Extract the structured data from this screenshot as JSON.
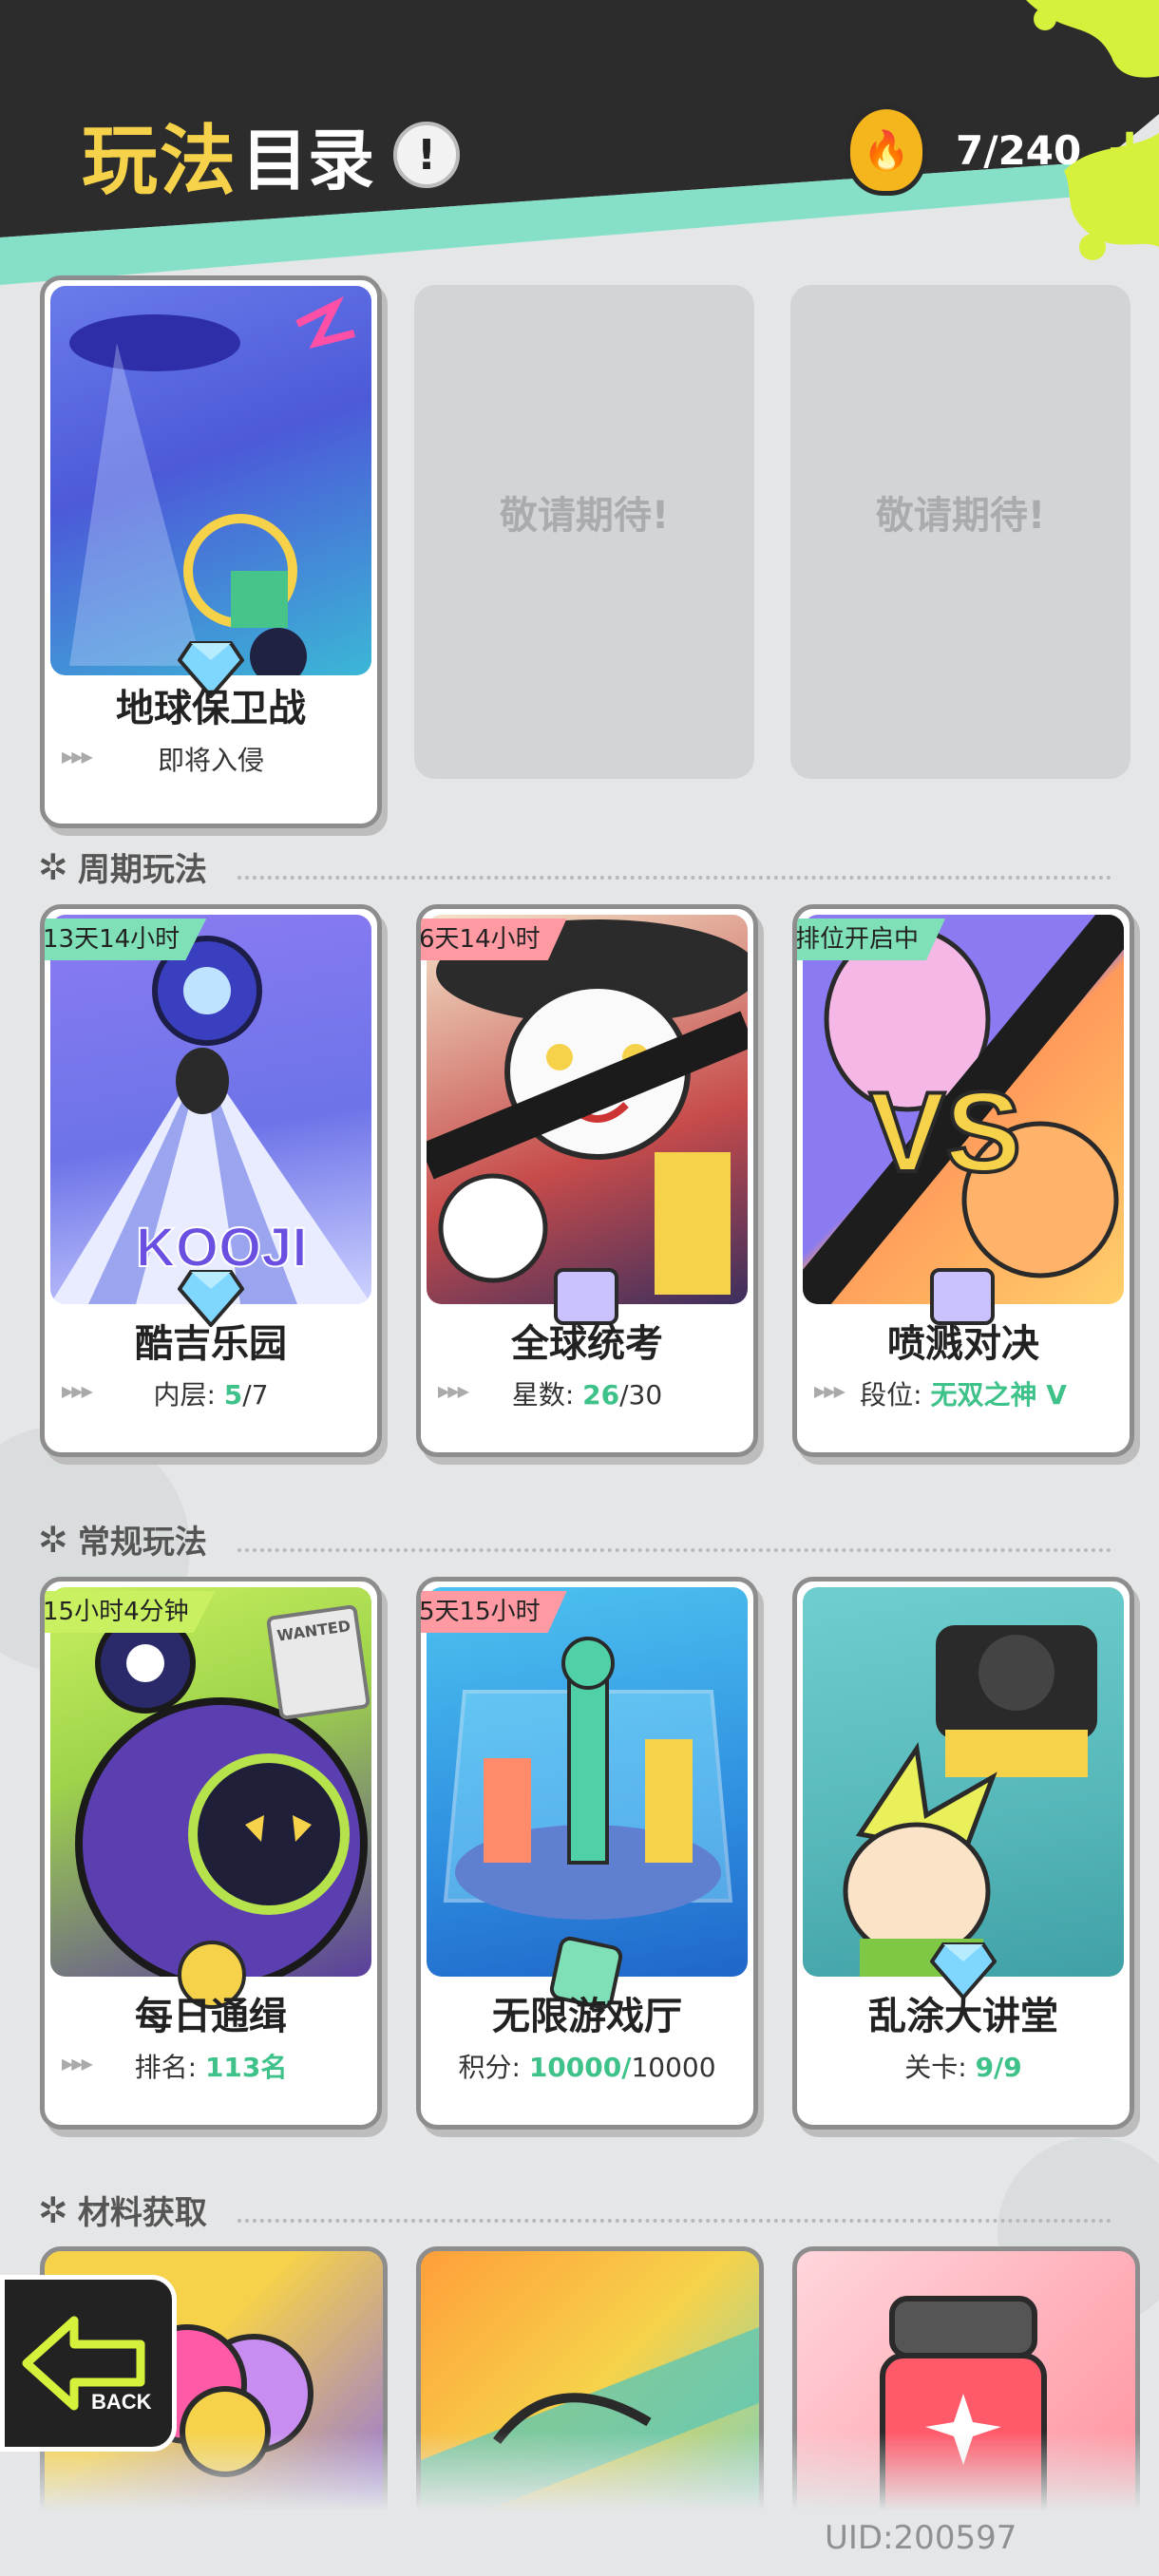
{
  "header": {
    "title_part1": "玩法",
    "title_part2": "目录",
    "info_glyph": "!",
    "currency_value": "7/240",
    "plus_glyph": "+"
  },
  "featured": {
    "card": {
      "title": "地球保卫战",
      "subtitle": "即将入侵"
    },
    "placeholder_1": "敬请期待!",
    "placeholder_2": "敬请期待!"
  },
  "sections": {
    "periodic": "周期玩法",
    "regular": "常规玩法",
    "materials": "材料获取"
  },
  "periodic_cards": [
    {
      "badge": "13天14小时",
      "title": "酷吉乐园",
      "sub_label": "内层:",
      "sub_value": "5",
      "sub_rest": "/7",
      "art_text": "KOOJI"
    },
    {
      "badge": "6天14小时",
      "title": "全球统考",
      "sub_label": "星数:",
      "sub_value": "26",
      "sub_rest": "/30"
    },
    {
      "badge": "排位开启中",
      "title": "喷溅对决",
      "sub_label": "段位:",
      "sub_value": "无双之神 V",
      "sub_rest": "",
      "art_text": "VS"
    }
  ],
  "regular_cards": [
    {
      "badge": "15小时4分钟",
      "title": "每日通缉",
      "sub_label": "排名:",
      "sub_value": "113名",
      "sub_rest": "",
      "tag": "WANTED"
    },
    {
      "badge": "5天15小时",
      "title": "无限游戏厅",
      "sub_label": "积分:",
      "sub_value": "10000/",
      "sub_rest": "10000"
    },
    {
      "badge": "",
      "title": "乱涂大讲堂",
      "sub_label": "关卡:",
      "sub_value": "9/9",
      "sub_rest": ""
    }
  ],
  "back_label": "BACK",
  "uid": "UID:200597",
  "colors": {
    "header_bg": "#2c2c2c",
    "accent_lime": "#d7f03c",
    "accent_teal": "#86e0c8",
    "highlight_green": "#3ec28a",
    "title_yellow": "#f6d24a"
  }
}
